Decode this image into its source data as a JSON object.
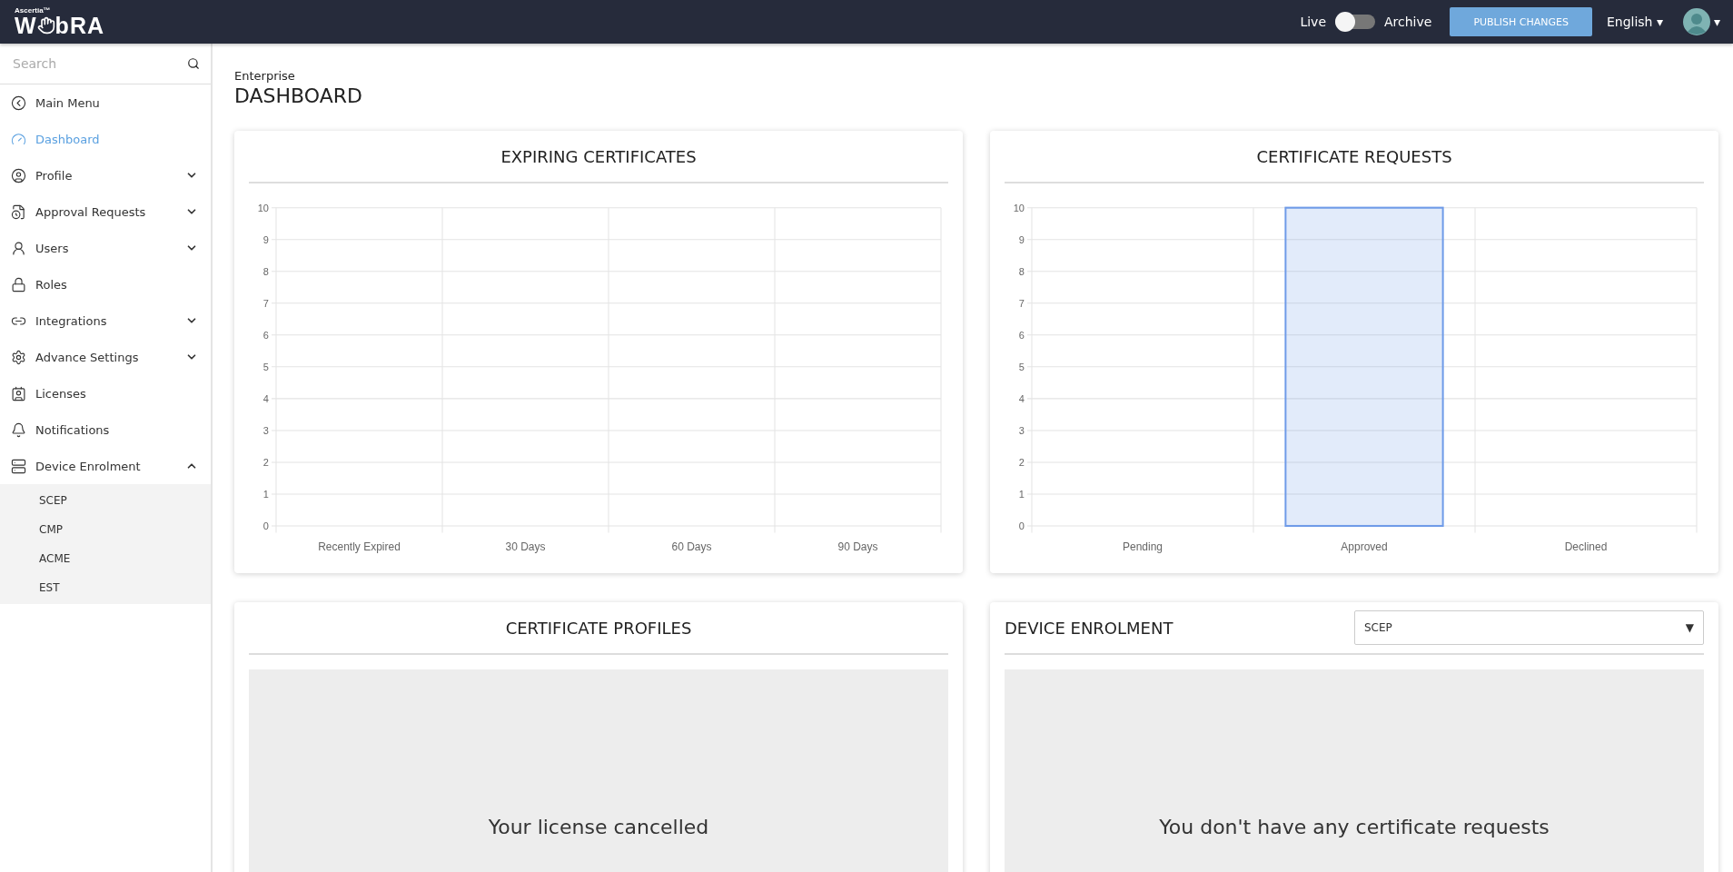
{
  "topbar": {
    "logo": {
      "brand": "Ascertia™",
      "left": "W",
      "right": "bRA"
    },
    "mode": {
      "left_label": "Live",
      "right_label": "Archive",
      "on": false
    },
    "publish_button": "PUBLISH CHANGES",
    "language": "English",
    "language_caret": "▾",
    "account_caret": "▾"
  },
  "sidebar": {
    "search": {
      "placeholder": "Search"
    },
    "items": [
      {
        "label": "Main Menu",
        "kind": "link",
        "selected": false
      },
      {
        "label": "Dashboard",
        "kind": "link",
        "selected": true
      },
      {
        "label": "Profile",
        "kind": "group",
        "selected": false,
        "expanded": false
      },
      {
        "label": "Approval Requests",
        "kind": "group",
        "selected": false,
        "expanded": false
      },
      {
        "label": "Users",
        "kind": "group",
        "selected": false,
        "expanded": false
      },
      {
        "label": "Roles",
        "kind": "link",
        "selected": false
      },
      {
        "label": "Integrations",
        "kind": "group",
        "selected": false,
        "expanded": false
      },
      {
        "label": "Advance Settings",
        "kind": "group",
        "selected": false,
        "expanded": false
      },
      {
        "label": "Licenses",
        "kind": "link",
        "selected": false
      },
      {
        "label": "Notifications",
        "kind": "link",
        "selected": false
      },
      {
        "label": "Device Enrolment",
        "kind": "group",
        "selected": false,
        "expanded": true,
        "children": [
          {
            "label": "SCEP",
            "selected": false
          },
          {
            "label": "CMP",
            "selected": false
          },
          {
            "label": "ACME",
            "selected": false
          },
          {
            "label": "EST",
            "selected": false
          }
        ]
      }
    ]
  },
  "page": {
    "breadcrumb": "Enterprise",
    "title": "DASHBOARD"
  },
  "cards": [
    {
      "kind": "chart",
      "title": "EXPIRING CERTIFICATES",
      "chart_data": {
        "type": "bar",
        "categories": [
          "Recently Expired",
          "30 Days",
          "60 Days",
          "90 Days"
        ],
        "values": [
          0,
          0,
          0,
          0
        ],
        "ylim": [
          0,
          10
        ],
        "yticks": [
          0,
          1,
          2,
          3,
          4,
          5,
          6,
          7,
          8,
          9,
          10
        ],
        "grid": true
      }
    },
    {
      "kind": "chart",
      "title": "CERTIFICATE REQUESTS",
      "chart_data": {
        "type": "bar",
        "categories": [
          "Pending",
          "Approved",
          "Declined"
        ],
        "values": [
          0,
          10,
          0
        ],
        "ylim": [
          0,
          10
        ],
        "yticks": [
          0,
          1,
          2,
          3,
          4,
          5,
          6,
          7,
          8,
          9,
          10
        ],
        "grid": true
      }
    },
    {
      "kind": "empty",
      "title": "CERTIFICATE PROFILES",
      "message": "Your license cancelled"
    },
    {
      "kind": "empty_select",
      "title": "DEVICE ENROLMENT",
      "select": {
        "value": "SCEP",
        "caret": "▼"
      },
      "message": "You don't have any certificate requests"
    }
  ]
}
